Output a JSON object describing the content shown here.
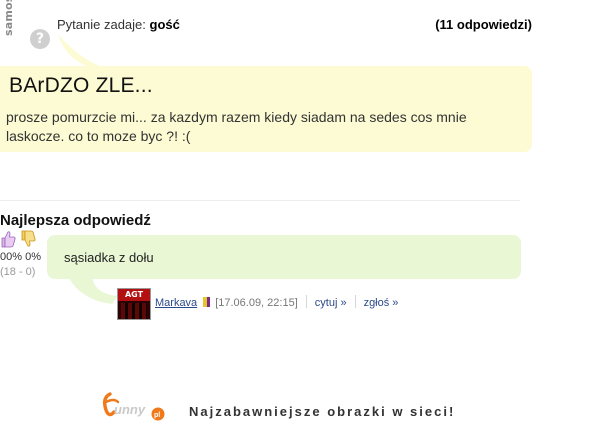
{
  "watermark": {
    "text": "samosia.pl",
    "icon": "question-mark-icon",
    "glyph": "?"
  },
  "question": {
    "asker_prefix": "Pytanie zadaje:",
    "asker_name": "gość",
    "answers_count": "(11 odpowiedzi)",
    "title": "BArDZO ZLE...",
    "body": "prosze pomurzcie mi... za kazdym razem kiedy siadam na sedes cos mnie laskocze. co to moze byc ?! :("
  },
  "best_answer": {
    "label": "Najlepsza odpowiedź",
    "percent": "00% 0%",
    "votes": "(18 - 0)",
    "text": "sąsiadka z dołu",
    "avatar_label": "AGT",
    "author": "Markava",
    "date": "[17.06.09, 22:15]",
    "quote_link": "cytuj »",
    "report_link": "zgłoś »"
  },
  "footer": {
    "logo_text": "Funny",
    "logo_suffix": "pl",
    "tagline": "Najzabawniejsze obrazki w sieci!"
  },
  "colors": {
    "question_bubble": "#fcfbd3",
    "answer_bubble": "#e9f7d4",
    "link": "#2b4a8a",
    "logo_orange": "#f07a1a"
  }
}
